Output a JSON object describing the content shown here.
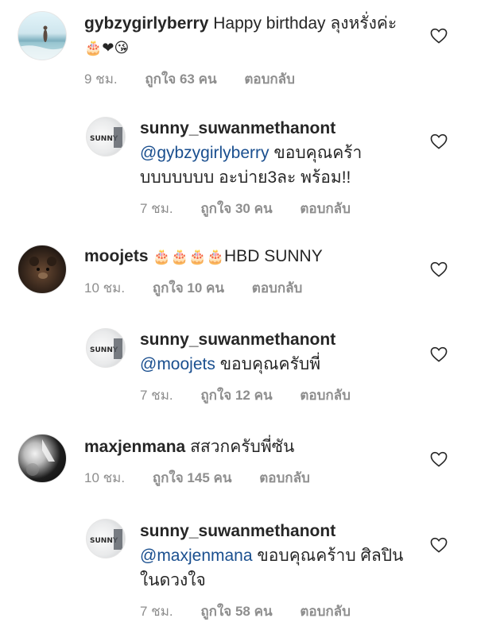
{
  "comments": [
    {
      "username": "gybzygirlyberry",
      "text": "Happy birthday ลุงหรั่งค่ะ",
      "emoji_line": "🎂❤😘",
      "time": "9 ชม.",
      "likes": "ถูกใจ 63 คน",
      "reply": "ตอบกลับ",
      "avatar": "beach-photo"
    },
    {
      "username": "sunny_suwanmethanont",
      "mention": "@gybzygirlyberry",
      "text": "ขอบคุณคร้า",
      "text2": "บบบบบบบ อะบ่าย3ละ พร้อม!!",
      "time": "7 ชม.",
      "likes": "ถูกใจ 30 คน",
      "reply": "ตอบกลับ",
      "avatar": "sunny-logo"
    },
    {
      "username": "moojets",
      "emoji": "🎂🎂🎂🎂",
      "text": "HBD SUNNY",
      "time": "10 ชม.",
      "likes": "ถูกใจ 10 คน",
      "reply": "ตอบกลับ",
      "avatar": "teddy-bear"
    },
    {
      "username": "sunny_suwanmethanont",
      "mention": "@moojets",
      "text": "ขอบคุณครับพี่",
      "time": "7 ชม.",
      "likes": "ถูกใจ 12 คน",
      "reply": "ตอบกลับ",
      "avatar": "sunny-logo"
    },
    {
      "username": "maxjenmana",
      "text": "สสวกครับพี่ซัน",
      "time": "10 ชม.",
      "likes": "ถูกใจ 145 คน",
      "reply": "ตอบกลับ",
      "avatar": "bw-portrait"
    },
    {
      "username": "sunny_suwanmethanont",
      "mention": "@maxjenmana",
      "text": "ขอบคุณคร้าบ ศิลปิน",
      "text2": "ในดวงใจ",
      "time": "7 ชม.",
      "likes": "ถูกใจ 58 คน",
      "reply": "ตอบกลับ",
      "avatar": "sunny-logo"
    }
  ],
  "avatar_logo_text": "SUNNY",
  "icons": {
    "like": "heart-outline-icon"
  },
  "colors": {
    "mention": "#1a4f8f",
    "meta": "#8e8e8e",
    "text": "#262626"
  }
}
